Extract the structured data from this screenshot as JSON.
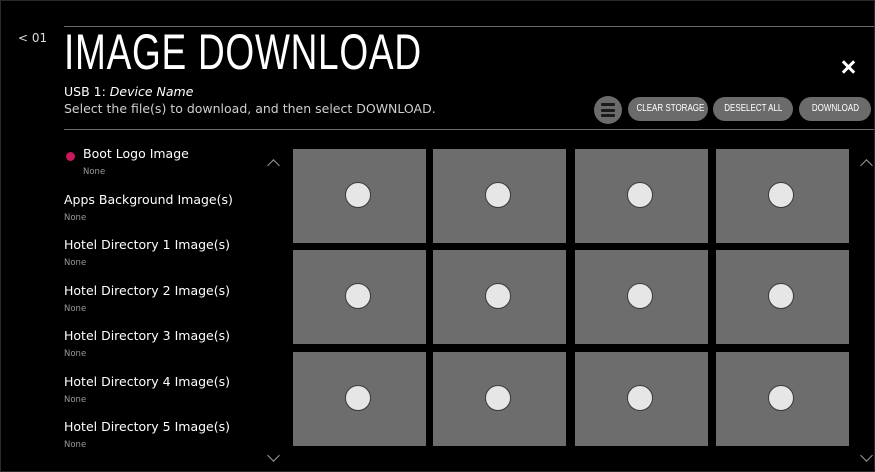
{
  "header": {
    "back_label": "< 01",
    "title": "IMAGE DOWNLOAD",
    "usb_prefix": "USB 1:",
    "device_name": "Device Name",
    "instruction": "Select the file(s) to download, and then select DOWNLOAD.",
    "close_icon": "close-icon"
  },
  "toolbar": {
    "storage_icon": "storage-list-icon",
    "clear_storage_label": "CLEAR STORAGE",
    "deselect_all_label": "DESELECT ALL",
    "download_label": "DOWNLOAD"
  },
  "categories": [
    {
      "name": "Boot Logo Image",
      "value": "None",
      "active": true
    },
    {
      "name": "Apps Background Image(s)",
      "value": "None"
    },
    {
      "name": "Hotel Directory 1 Image(s)",
      "value": "None"
    },
    {
      "name": "Hotel Directory 2 Image(s)",
      "value": "None"
    },
    {
      "name": "Hotel Directory 3 Image(s)",
      "value": "None"
    },
    {
      "name": "Hotel Directory 4 Image(s)",
      "value": "None"
    },
    {
      "name": "Hotel Directory 5 Image(s)",
      "value": "None"
    }
  ],
  "thumbnails": {
    "rows": 3,
    "columns": 4,
    "selected": [
      false,
      false,
      false,
      false,
      false,
      false,
      false,
      false,
      false,
      false,
      false,
      false
    ]
  },
  "colors": {
    "accent": "#c8185a",
    "tile": "#6d6d6d",
    "button": "#6b6b6b"
  }
}
